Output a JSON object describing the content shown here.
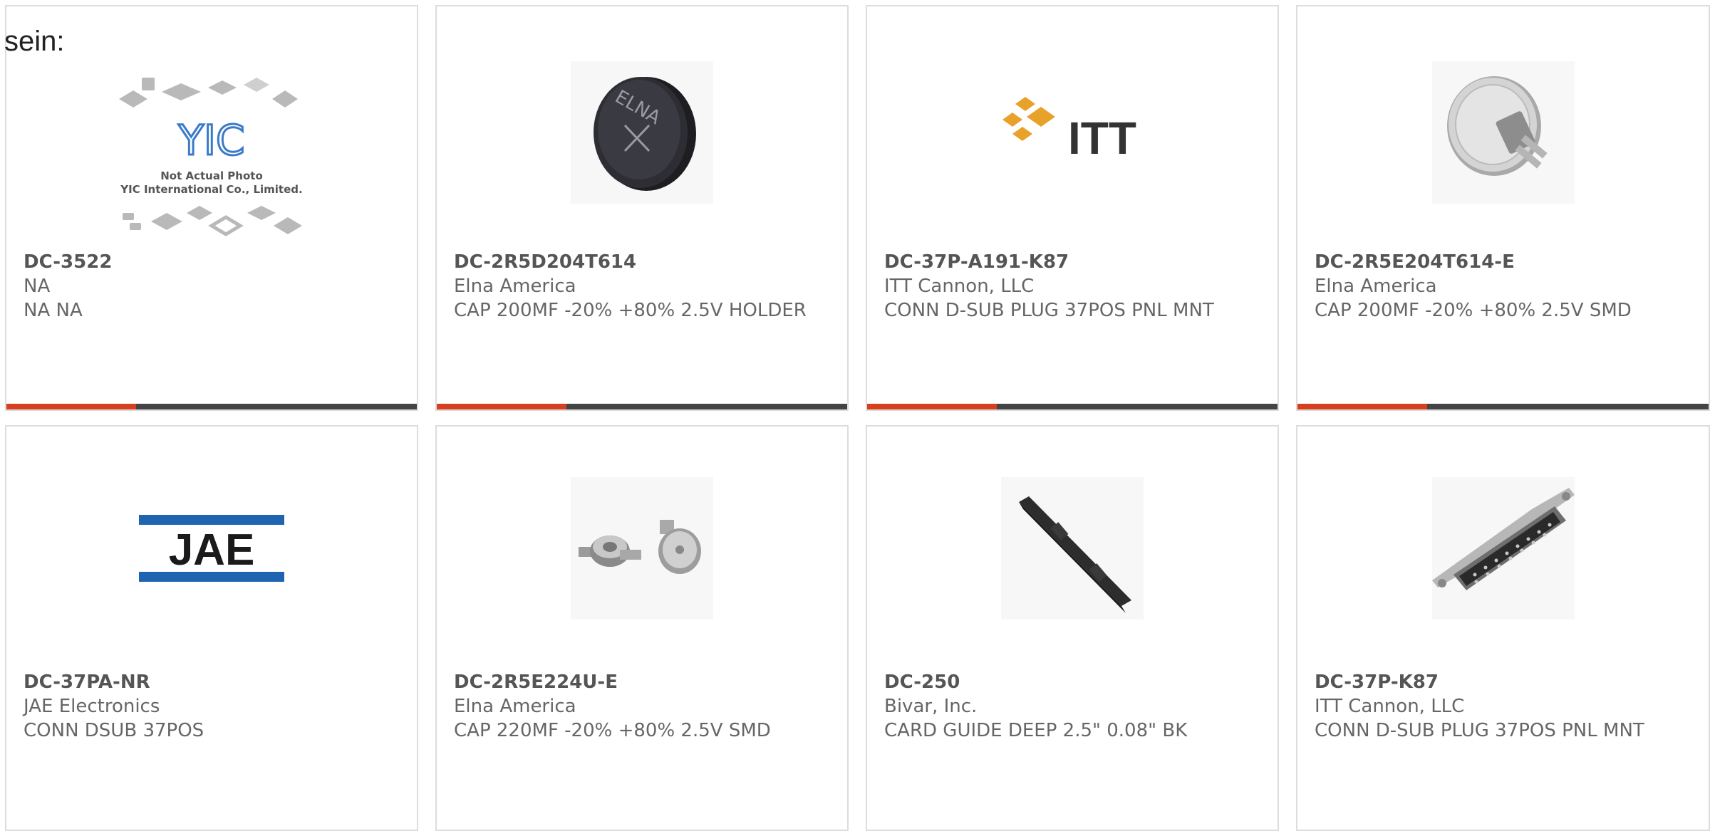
{
  "header": {
    "label": "sein:"
  },
  "colors": {
    "accent": "#d7401e",
    "bar": "#444444",
    "border": "#dddddd"
  },
  "cards": [
    {
      "part_number": "DC-3522",
      "manufacturer": "NA",
      "description": "NA NA",
      "image": {
        "icon": "yic-placeholder-icon",
        "line1": "Not Actual Photo",
        "line2": "YIC International Co., Limited.",
        "logo_text": "YIC"
      }
    },
    {
      "part_number": "DC-2R5D204T614",
      "manufacturer": "Elna America",
      "description": "CAP 200MF -20% +80% 2.5V HOLDER",
      "image": {
        "icon": "coin-cell-capacitor-icon",
        "engraving": "ELNA"
      }
    },
    {
      "part_number": "DC-37P-A191-K87",
      "manufacturer": "ITT Cannon, LLC",
      "description": "CONN D-SUB PLUG 37POS PNL MNT",
      "image": {
        "icon": "itt-logo-icon",
        "logo_text": "ITT"
      }
    },
    {
      "part_number": "DC-2R5E204T614-E",
      "manufacturer": "Elna America",
      "description": "CAP 200MF -20% +80% 2.5V SMD",
      "image": {
        "icon": "coin-cell-tab-capacitor-icon"
      }
    },
    {
      "part_number": "DC-37PA-NR",
      "manufacturer": "JAE Electronics",
      "description": "CONN DSUB 37POS",
      "image": {
        "icon": "jae-logo-icon",
        "logo_text": "JAE"
      }
    },
    {
      "part_number": "DC-2R5E224U-E",
      "manufacturer": "Elna America",
      "description": "CAP 220MF -20% +80% 2.5V SMD",
      "image": {
        "icon": "smd-capacitor-pair-icon"
      }
    },
    {
      "part_number": "DC-250",
      "manufacturer": "Bivar, Inc.",
      "description": "CARD GUIDE DEEP 2.5\" 0.08\" BK",
      "image": {
        "icon": "card-guide-icon"
      }
    },
    {
      "part_number": "DC-37P-K87",
      "manufacturer": "ITT Cannon, LLC",
      "description": "CONN D-SUB PLUG 37POS PNL MNT",
      "image": {
        "icon": "dsub-connector-icon"
      }
    }
  ]
}
